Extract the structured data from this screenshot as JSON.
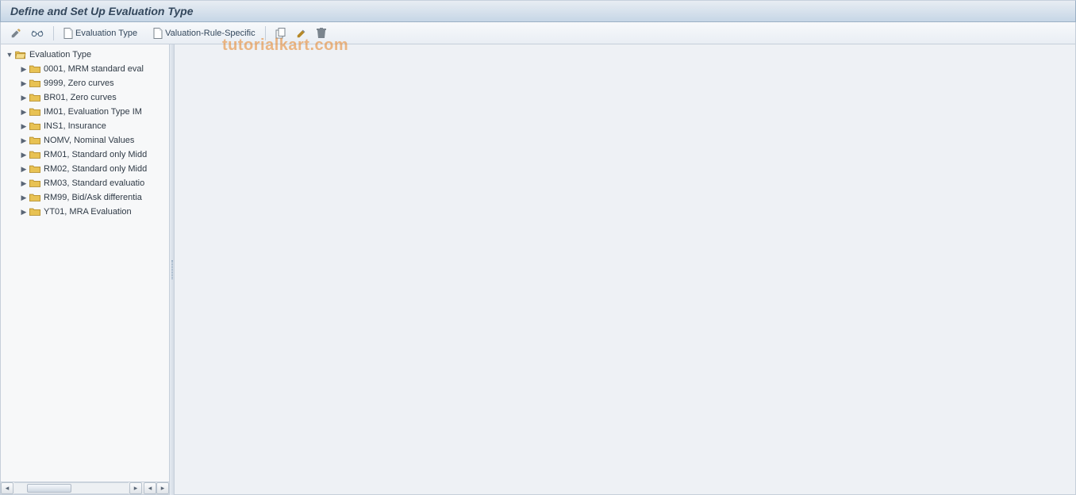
{
  "header": {
    "title": "Define and Set Up Evaluation Type"
  },
  "toolbar": {
    "evaluation_type_label": "Evaluation Type",
    "valuation_rule_label": "Valuation-Rule-Specific"
  },
  "tree": {
    "root_label": "Evaluation Type",
    "items": [
      {
        "label": "0001, MRM standard eval"
      },
      {
        "label": "9999, Zero curves"
      },
      {
        "label": "BR01, Zero curves"
      },
      {
        "label": "IM01, Evaluation Type IM"
      },
      {
        "label": "INS1, Insurance"
      },
      {
        "label": "NOMV, Nominal Values"
      },
      {
        "label": "RM01, Standard only Midd"
      },
      {
        "label": "RM02, Standard only Midd"
      },
      {
        "label": "RM03, Standard evaluatio"
      },
      {
        "label": "RM99, Bid/Ask differentia"
      },
      {
        "label": "YT01, MRA Evaluation"
      }
    ]
  },
  "watermark": "tutorialkart.com"
}
